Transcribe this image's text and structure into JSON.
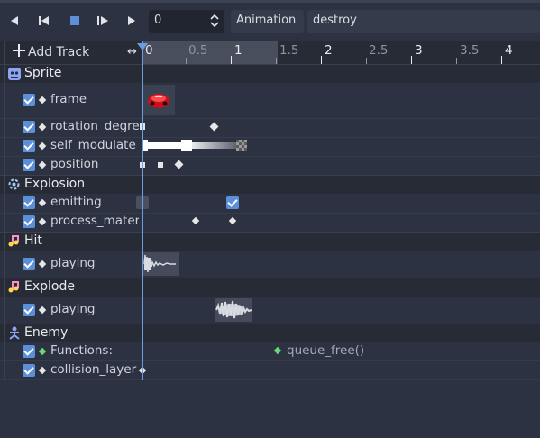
{
  "toolbar": {
    "frame_value": "0",
    "animation_label": "Animation",
    "animation_name": "destroy"
  },
  "ruler": {
    "add_track_label": "Add Track",
    "ticks": [
      "0",
      "0.5",
      "1",
      "1.5",
      "2",
      "2.5",
      "3",
      "3.5",
      "4"
    ]
  },
  "groups": [
    {
      "name": "Sprite",
      "icon": "sprite-icon",
      "tracks": [
        "frame",
        "rotation_degrees",
        "self_modulate",
        "position"
      ]
    },
    {
      "name": "Explosion",
      "icon": "particles-icon",
      "tracks": [
        "emitting",
        "process_material"
      ]
    },
    {
      "name": "Hit",
      "icon": "audio-icon",
      "tracks": [
        "playing"
      ]
    },
    {
      "name": "Explode",
      "icon": "audio-icon",
      "tracks": [
        "playing"
      ]
    },
    {
      "name": "Enemy",
      "icon": "node-icon",
      "tracks": [
        "Functions:",
        "collision_layer"
      ]
    }
  ],
  "method_key_label": "queue_free()",
  "colors": {
    "background": "#2c3241",
    "accent": "#5b8fd8",
    "playhead": "#6d9de0",
    "method_key": "#66d977"
  }
}
